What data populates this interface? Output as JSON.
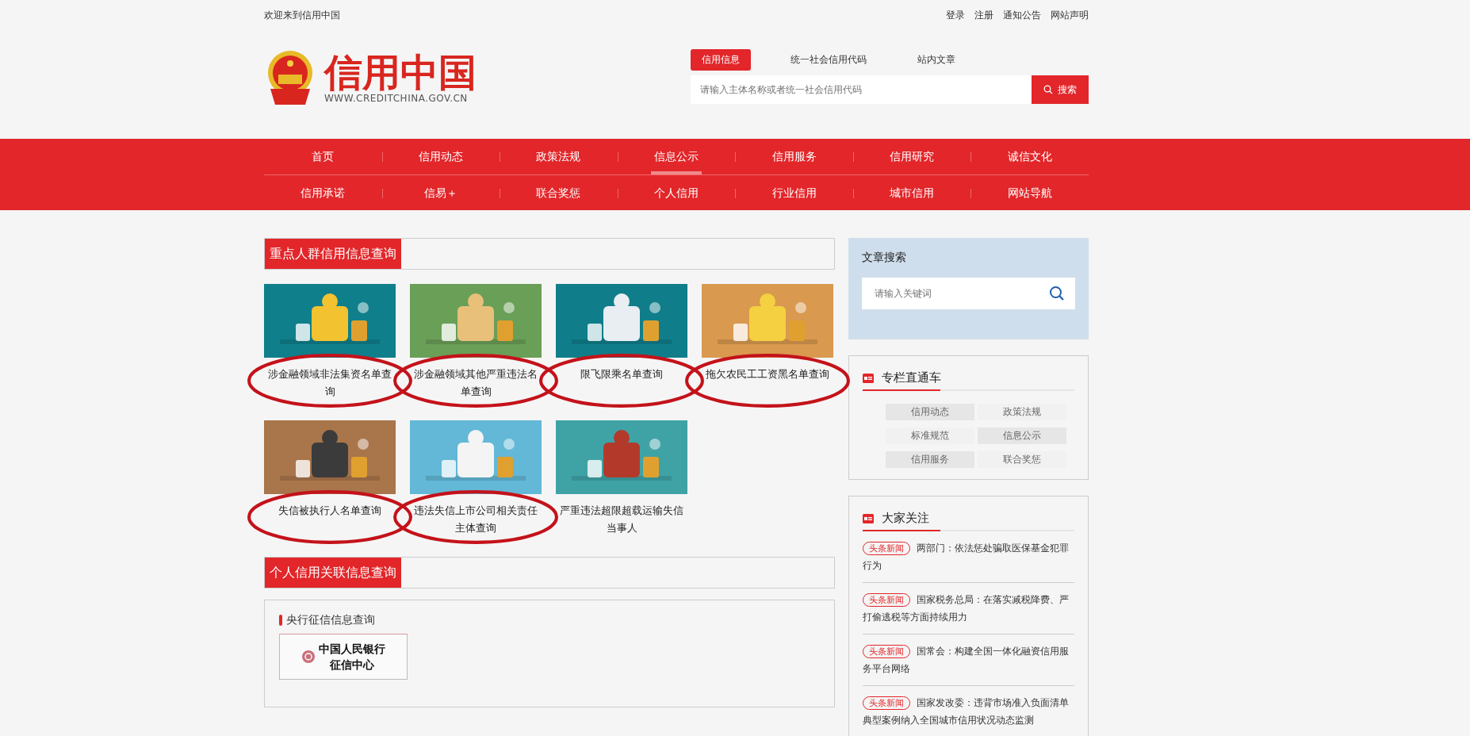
{
  "top_bar": {
    "welcome": "欢迎来到信用中国",
    "links": [
      "登录",
      "注册",
      "通知公告",
      "网站声明"
    ]
  },
  "logo": {
    "title": "信用中国",
    "url": "WWW.CREDITCHINA.GOV.CN"
  },
  "search": {
    "tabs": [
      {
        "label": "信用信息",
        "selected": true
      },
      {
        "label": "统一社会信用代码",
        "selected": false
      },
      {
        "label": "站内文章",
        "selected": false
      }
    ],
    "placeholder": "请输入主体名称或者统一社会信用代码",
    "button": "搜索"
  },
  "nav": [
    [
      {
        "label": "首页",
        "selected": false
      },
      {
        "label": "信用动态",
        "selected": false
      },
      {
        "label": "政策法规",
        "selected": false
      },
      {
        "label": "信息公示",
        "selected": true
      },
      {
        "label": "信用服务",
        "selected": false
      },
      {
        "label": "信用研究",
        "selected": false
      },
      {
        "label": "诚信文化",
        "selected": false
      }
    ],
    [
      {
        "label": "信用承诺",
        "selected": false
      },
      {
        "label": "信易＋",
        "selected": false
      },
      {
        "label": "联合奖惩",
        "selected": false
      },
      {
        "label": "个人信用",
        "selected": false
      },
      {
        "label": "行业信用",
        "selected": false
      },
      {
        "label": "城市信用",
        "selected": false
      },
      {
        "label": "网站导航",
        "selected": false
      }
    ]
  ],
  "section1": {
    "title": "重点人群信用信息查询",
    "tiles": [
      {
        "caption": "涉金融领域非法集资名单查询",
        "circled": true
      },
      {
        "caption": "涉金融领域其他严重违法名单查询",
        "circled": true
      },
      {
        "caption": "限飞限乘名单查询",
        "circled": true
      },
      {
        "caption": "拖欠农民工工资黑名单查询",
        "circled": true
      },
      {
        "caption": "失信被执行人名单查询",
        "circled": true
      },
      {
        "caption": "违法失信上市公司相关责任主体查询",
        "circled": true
      },
      {
        "caption": "严重违法超限超载运输失信当事人",
        "circled": false
      }
    ]
  },
  "section2": {
    "title": "个人信用关联信息查询",
    "subtitle": "央行征信信息查询",
    "bank_lines": [
      "中国人民银行",
      "征信中心"
    ]
  },
  "article_search": {
    "title": "文章搜索",
    "placeholder": "请输入关键词"
  },
  "columns_box": {
    "title": "专栏直通车",
    "links": [
      "信用动态",
      "政策法规",
      "标准规范",
      "信息公示",
      "信用服务",
      "联合奖惩"
    ]
  },
  "focus_box": {
    "title": "大家关注",
    "items": [
      {
        "tag": "头条新闻",
        "text": "两部门：依法惩处骗取医保基金犯罪行为"
      },
      {
        "tag": "头条新闻",
        "text": "国家税务总局：在落实减税降费、严打偷逃税等方面持续用力"
      },
      {
        "tag": "头条新闻",
        "text": "国常会：构建全国一体化融资信用服务平台网络"
      },
      {
        "tag": "头条新闻",
        "text": "国家发改委：违背市场准入负面清单典型案例纳入全国城市信用状况动态监测"
      }
    ]
  }
}
